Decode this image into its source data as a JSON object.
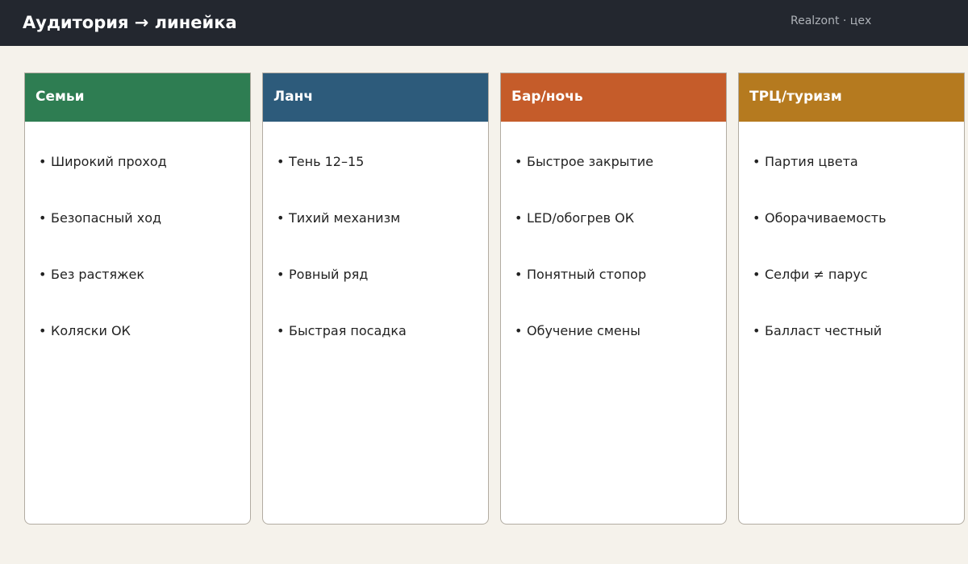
{
  "header": {
    "title": "Аудитория → линейка",
    "brand": "Realzont · цех"
  },
  "colors": {
    "topbar": "#23272f",
    "background": "#f5f2eb",
    "families": "#2e7d52",
    "lunch": "#2d5b7b",
    "bar": "#c55c2a",
    "mall": "#b57a1f"
  },
  "bullet": "•",
  "columns": [
    {
      "title": "Семьи",
      "color": "#2e7d52",
      "items": [
        "Широкий проход",
        "Безопасный ход",
        "Без растяжек",
        "Коляски ОК"
      ]
    },
    {
      "title": "Ланч",
      "color": "#2d5b7b",
      "items": [
        "Тень 12–15",
        "Тихий механизм",
        "Ровный ряд",
        "Быстрая посадка"
      ]
    },
    {
      "title": "Бар/ночь",
      "color": "#c55c2a",
      "items": [
        "Быстрое закрытие",
        "LED/обогрев ОК",
        "Понятный стопор",
        "Обучение смены"
      ]
    },
    {
      "title": "ТРЦ/туризм",
      "color": "#b57a1f",
      "items": [
        "Партия цвета",
        "Оборачиваемость",
        "Селфи ≠ парус",
        "Балласт честный"
      ]
    }
  ]
}
